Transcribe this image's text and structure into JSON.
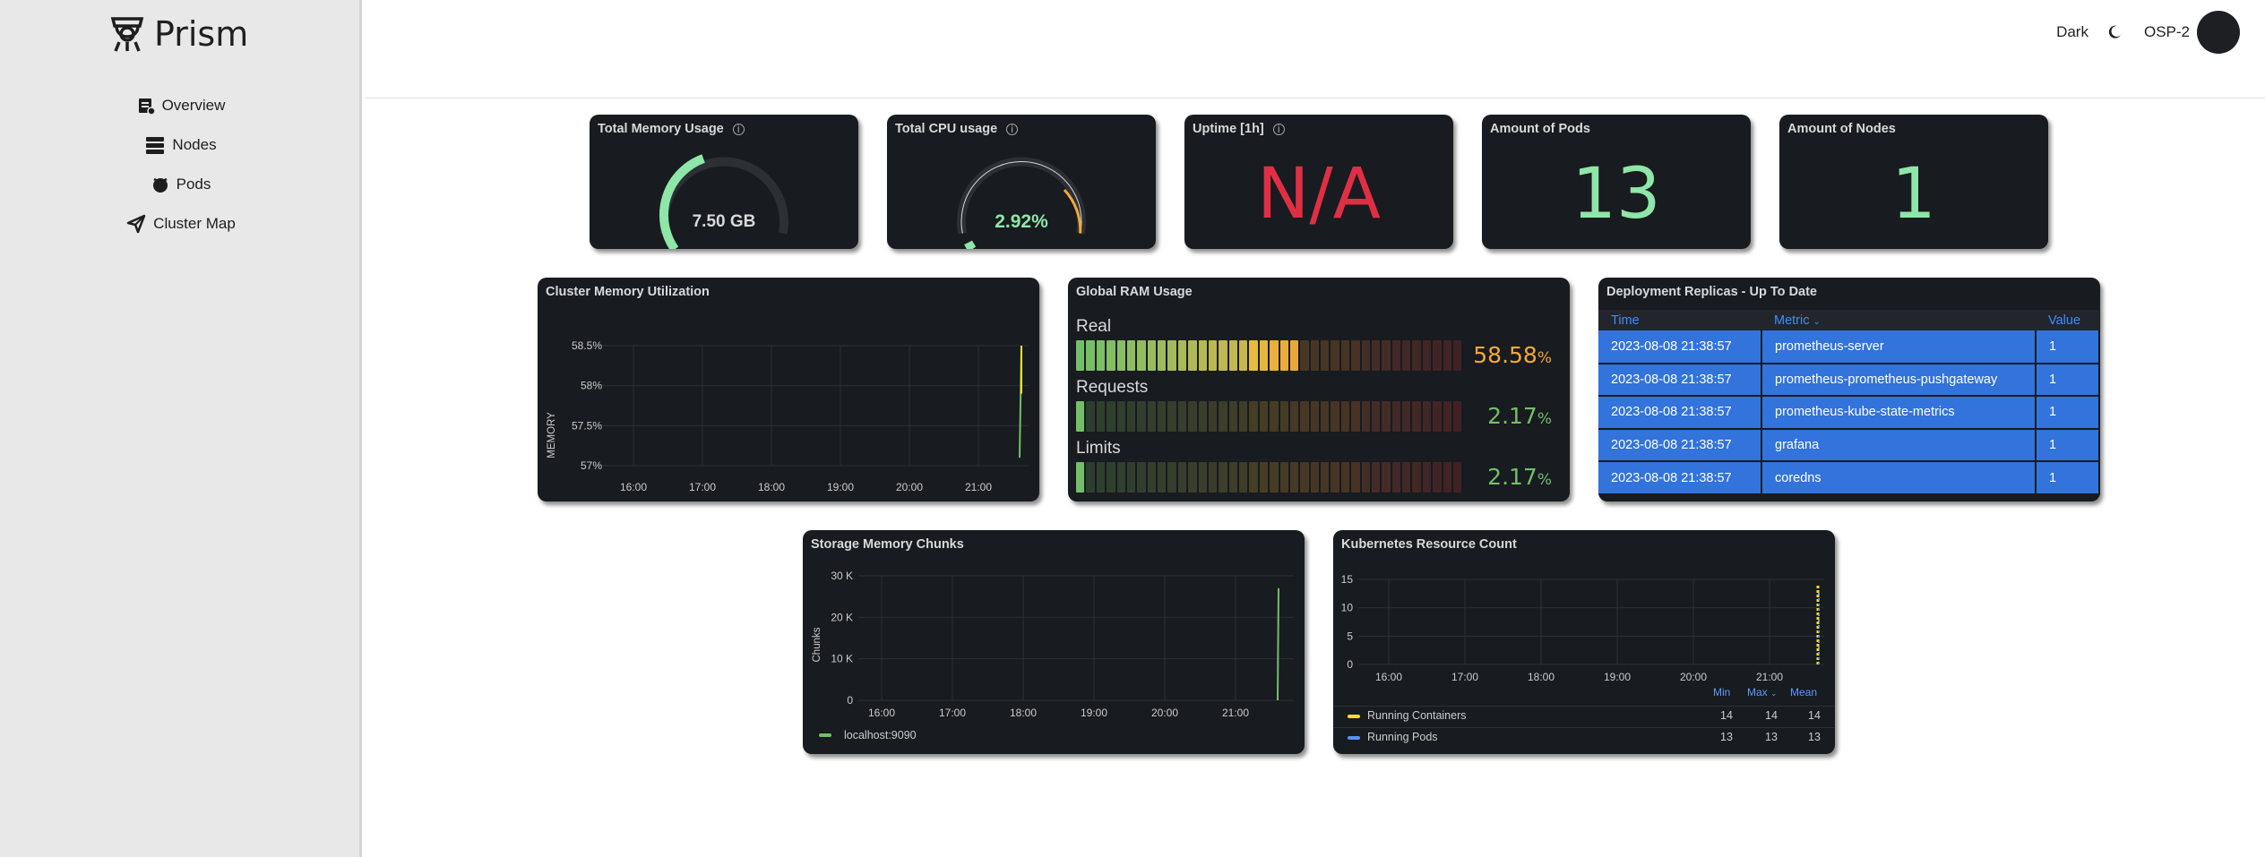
{
  "app": {
    "name": "Prism",
    "theme_label": "Dark",
    "cluster": "OSP-2"
  },
  "sidebar": {
    "items": [
      {
        "label": "Overview",
        "icon": "overview-icon"
      },
      {
        "label": "Nodes",
        "icon": "nodes-icon"
      },
      {
        "label": "Pods",
        "icon": "pods-icon"
      },
      {
        "label": "Cluster Map",
        "icon": "map-icon"
      }
    ]
  },
  "stats": {
    "memory": {
      "title": "Total Memory Usage",
      "value": "7.50 GB",
      "fraction": 0.42,
      "color": "#8ee6a8"
    },
    "cpu": {
      "title": "Total CPU usage",
      "value": "2.92%",
      "fraction": 0.03,
      "color": "#8ee6a8"
    },
    "uptime": {
      "title": "Uptime [1h]",
      "value": "N/A",
      "color": "#e02f44"
    },
    "pods": {
      "title": "Amount of Pods",
      "value": "13",
      "color": "#8ee6a8"
    },
    "nodes": {
      "title": "Amount of Nodes",
      "value": "1",
      "color": "#8ee6a8"
    }
  },
  "cluster_memory": {
    "title": "Cluster Memory Utilization",
    "ylabel": "MEMORY",
    "yticks": [
      "58.5%",
      "58%",
      "57.5%",
      "57%"
    ],
    "xticks": [
      "16:00",
      "17:00",
      "18:00",
      "19:00",
      "20:00",
      "21:00"
    ]
  },
  "ram": {
    "title": "Global RAM Usage",
    "rows": [
      {
        "label": "Real",
        "value": "58.58",
        "unit": "%",
        "fraction": 0.5858,
        "color": "#f2a93b"
      },
      {
        "label": "Requests",
        "value": "2.17",
        "unit": "%",
        "fraction": 0.0217,
        "color": "#73bf69"
      },
      {
        "label": "Limits",
        "value": "2.17",
        "unit": "%",
        "fraction": 0.0217,
        "color": "#73bf69"
      }
    ]
  },
  "replicas": {
    "title": "Deployment Replicas - Up To Date",
    "headers": [
      "Time",
      "Metric",
      "Value"
    ],
    "rows": [
      [
        "2023-08-08 21:38:57",
        "prometheus-server",
        "1"
      ],
      [
        "2023-08-08 21:38:57",
        "prometheus-prometheus-pushgateway",
        "1"
      ],
      [
        "2023-08-08 21:38:57",
        "prometheus-kube-state-metrics",
        "1"
      ],
      [
        "2023-08-08 21:38:57",
        "grafana",
        "1"
      ],
      [
        "2023-08-08 21:38:57",
        "coredns",
        "1"
      ]
    ]
  },
  "storage": {
    "title": "Storage Memory Chunks",
    "ylabel": "Chunks",
    "yticks": [
      "30 K",
      "20 K",
      "10 K",
      "0"
    ],
    "xticks": [
      "16:00",
      "17:00",
      "18:00",
      "19:00",
      "20:00",
      "21:00"
    ],
    "legend": "localhost:9090",
    "legend_color": "#73bf69"
  },
  "k8s": {
    "title": "Kubernetes Resource Count",
    "yticks": [
      "15",
      "10",
      "5",
      "0"
    ],
    "xticks": [
      "16:00",
      "17:00",
      "18:00",
      "19:00",
      "20:00",
      "21:00"
    ],
    "legend_headers": [
      "Min",
      "Max",
      "Mean"
    ],
    "legend": [
      {
        "name": "Running Containers",
        "color": "#fade2a",
        "min": "14",
        "max": "14",
        "mean": "14"
      },
      {
        "name": "Running Pods",
        "color": "#5794f2",
        "min": "13",
        "max": "13",
        "mean": "13"
      }
    ]
  },
  "chart_data": [
    {
      "type": "line",
      "title": "Cluster Memory Utilization",
      "ylabel": "MEMORY",
      "ylim": [
        56.9,
        58.7
      ],
      "x": [
        "16:00",
        "17:00",
        "18:00",
        "19:00",
        "20:00",
        "21:00"
      ],
      "series": [
        {
          "values_note_x": [
            "21:36",
            "21:38"
          ],
          "values": [
            57.1,
            58.5
          ]
        }
      ]
    },
    {
      "type": "line",
      "title": "Storage Memory Chunks",
      "ylabel": "Chunks",
      "ylim": [
        0,
        30000
      ],
      "series": [
        {
          "name": "localhost:9090",
          "x": [
            "21:36",
            "21:38"
          ],
          "values": [
            0,
            27000
          ]
        }
      ]
    },
    {
      "type": "line",
      "title": "Kubernetes Resource Count",
      "ylim": [
        0,
        15
      ],
      "series": [
        {
          "name": "Running Containers",
          "x": [
            "21:36",
            "21:38"
          ],
          "values": [
            14,
            14
          ]
        },
        {
          "name": "Running Pods",
          "x": [
            "21:36",
            "21:38"
          ],
          "values": [
            13,
            13
          ]
        }
      ]
    }
  ]
}
